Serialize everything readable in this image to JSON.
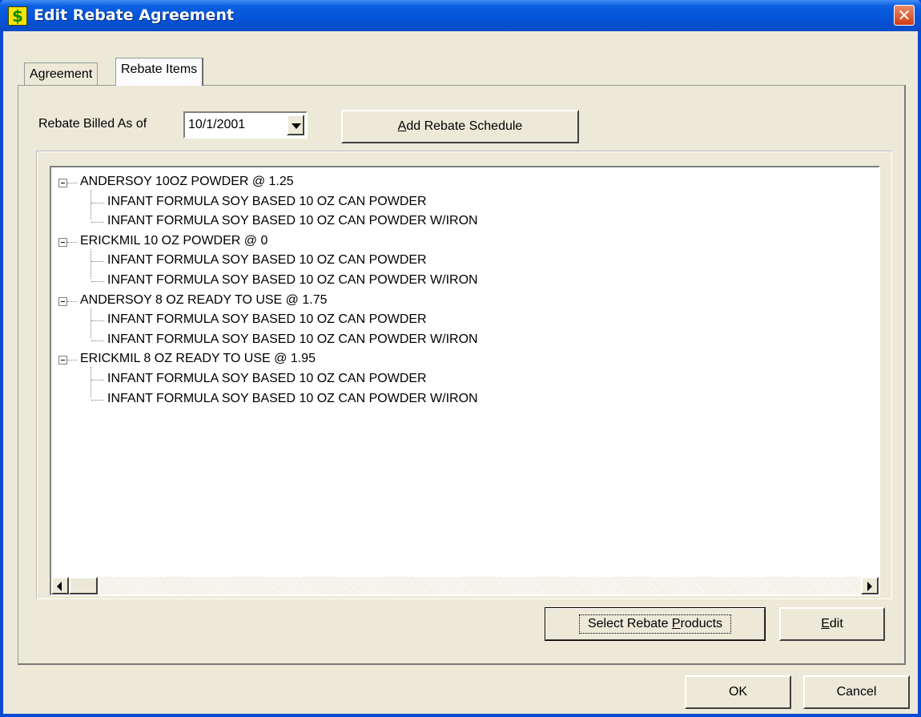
{
  "window": {
    "title": "Edit Rebate Agreement",
    "icon": "dollar-icon",
    "close_glyph": "✕"
  },
  "tabs": [
    {
      "label": "Agreement",
      "active": false
    },
    {
      "label": "Rebate Items",
      "active": true
    }
  ],
  "rebate_billed": {
    "label": "Rebate Billed As of",
    "value": "10/1/2001"
  },
  "add_schedule_button": {
    "pre": "",
    "accel": "A",
    "post": "dd Rebate Schedule"
  },
  "tree": [
    {
      "label": "ANDERSOY 10OZ POWDER @ 1.25",
      "children": [
        "INFANT FORMULA SOY BASED 10 OZ CAN POWDER",
        "INFANT FORMULA SOY BASED 10 OZ CAN POWDER W/IRON"
      ]
    },
    {
      "label": "ERICKMIL 10 OZ POWDER @ 0",
      "children": [
        "INFANT FORMULA SOY BASED 10 OZ CAN POWDER",
        "INFANT FORMULA SOY BASED 10 OZ CAN POWDER W/IRON"
      ]
    },
    {
      "label": "ANDERSOY 8 OZ READY TO USE @ 1.75",
      "children": [
        "INFANT FORMULA SOY BASED 10 OZ CAN POWDER",
        "INFANT FORMULA SOY BASED 10 OZ CAN POWDER W/IRON"
      ]
    },
    {
      "label": "ERICKMIL 8 OZ READY TO USE @ 1.95",
      "children": [
        "INFANT FORMULA SOY BASED 10 OZ CAN POWDER",
        "INFANT FORMULA SOY BASED 10 OZ CAN POWDER W/IRON"
      ]
    }
  ],
  "select_products_button": {
    "pre": "Select Rebate ",
    "accel": "P",
    "post": "roducts"
  },
  "edit_button": {
    "pre": "",
    "accel": "E",
    "post": "dit"
  },
  "ok_button": "OK",
  "cancel_button": "Cancel",
  "colors": {
    "titlebar": "#0653d8",
    "face": "#ece9d8",
    "close": "#d23c12"
  }
}
